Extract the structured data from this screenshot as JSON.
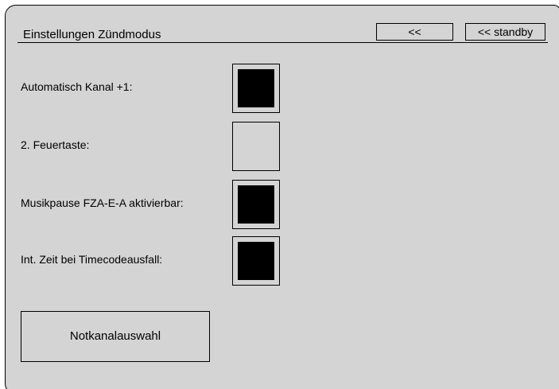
{
  "header": {
    "title": "Einstellungen Zündmodus",
    "back_label": "<<",
    "standby_label": "<< standby"
  },
  "settings": [
    {
      "label": "Automatisch Kanal +1:",
      "checked": true
    },
    {
      "label": "2. Feuertaste:",
      "checked": false
    },
    {
      "label": "Musikpause FZA-E-A aktivierbar:",
      "checked": true
    },
    {
      "label": "Int. Zeit bei Timecodeausfall:",
      "checked": true
    }
  ],
  "emergency_button_label": "Notkanalauswahl",
  "colors": {
    "panel_background": "#d4d4d4",
    "check_fill": "#000000"
  }
}
